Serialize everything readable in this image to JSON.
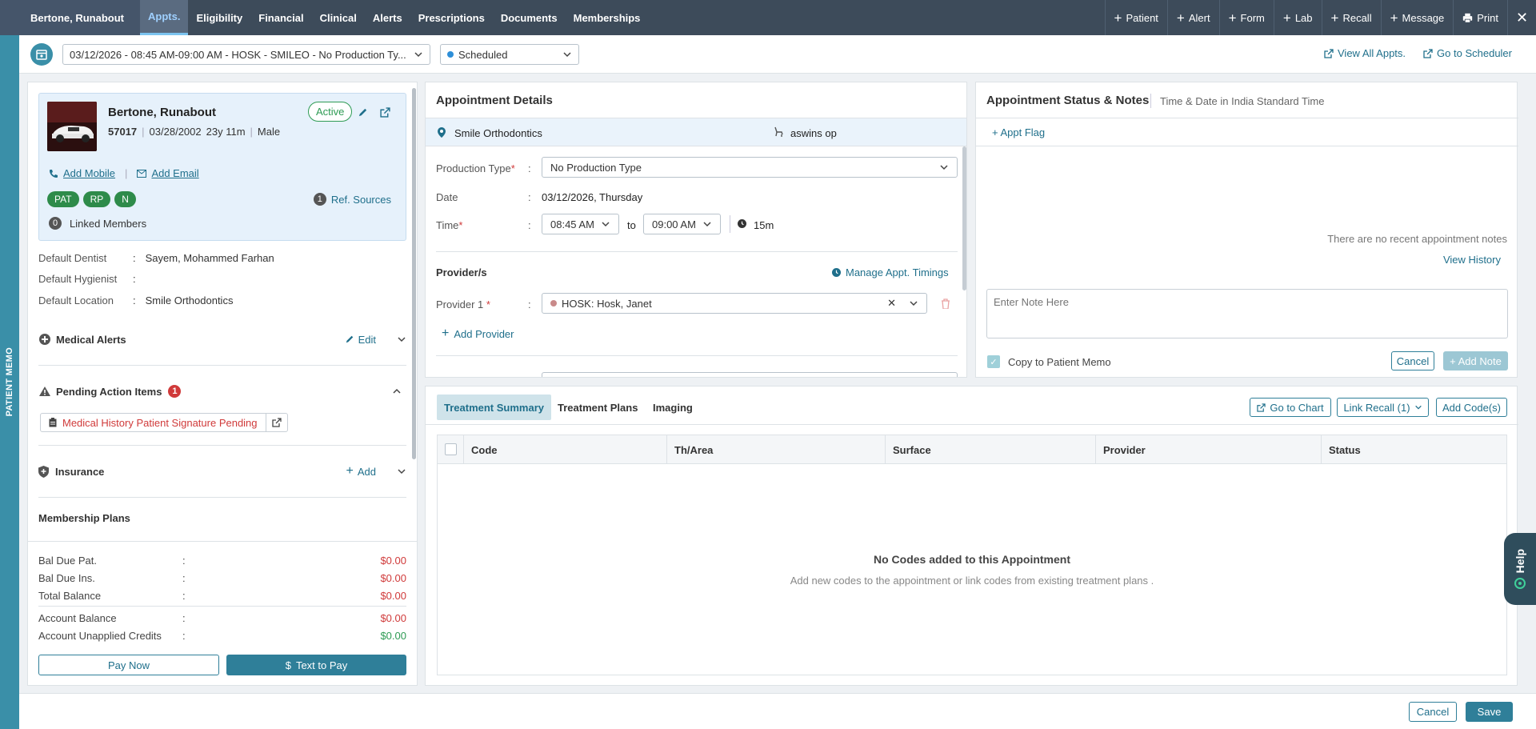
{
  "topbar": {
    "patient": "Bertone, Runabout",
    "nav": [
      "Appts.",
      "Eligibility",
      "Financial",
      "Clinical",
      "Alerts",
      "Prescriptions",
      "Documents",
      "Memberships"
    ],
    "actions": [
      "Patient",
      "Alert",
      "Form",
      "Lab",
      "Recall",
      "Message"
    ],
    "print": "Print"
  },
  "memo_strip": "PATIENT MEMO",
  "appt_bar": {
    "appointment": "03/12/2026 - 08:45 AM-09:00 AM - HOSK - SMILEO - No Production Ty...",
    "status": "Scheduled",
    "view_all": "View All Appts.",
    "go_scheduler": "Go to Scheduler"
  },
  "patient": {
    "name": "Bertone, Runabout",
    "id": "57017",
    "dob": "03/28/2002",
    "age": "23y 11m",
    "gender": "Male",
    "status": "Active",
    "add_mobile": "Add Mobile",
    "add_email": "Add Email",
    "pills": [
      "PAT",
      "RP",
      "N"
    ],
    "ref_count": "1",
    "ref_label": "Ref. Sources",
    "linked_count": "0",
    "linked_label": "Linked Members"
  },
  "defaults": [
    {
      "k": "Default Dentist",
      "v": "Sayem, Mohammed Farhan"
    },
    {
      "k": "Default Hygienist",
      "v": ""
    },
    {
      "k": "Default Location",
      "v": "Smile Orthodontics"
    }
  ],
  "sections": {
    "medical_alerts": "Medical Alerts",
    "edit": "Edit",
    "pending": "Pending Action Items",
    "pending_count": "1",
    "pending_item": "Medical History Patient Signature Pending",
    "insurance": "Insurance",
    "add": "Add",
    "membership": "Membership Plans"
  },
  "balances": [
    {
      "k": "Bal Due Pat.",
      "v": "$0.00",
      "color": "#d03a3a"
    },
    {
      "k": "Bal Due Ins.",
      "v": "$0.00",
      "color": "#d03a3a"
    },
    {
      "k": "Total Balance",
      "v": "$0.00",
      "color": "#d03a3a"
    },
    {
      "k": "Account Balance",
      "v": "$0.00",
      "color": "#d03a3a"
    },
    {
      "k": "Account Unapplied Credits",
      "v": "$0.00",
      "color": "#2e9b54"
    }
  ],
  "pay_now": "Pay Now",
  "text_to_pay": "Text to Pay",
  "appt_details": {
    "title": "Appointment Details",
    "location": "Smile Orthodontics",
    "operatory": "aswins op",
    "production_label": "Production Type",
    "production_value": "No Production Type",
    "date_label": "Date",
    "date_value": "03/12/2026, Thursday",
    "time_label": "Time",
    "time_from": "08:45 AM",
    "to": "to",
    "time_to": "09:00 AM",
    "duration": "15m",
    "providers_label": "Provider/s",
    "manage_timings": "Manage Appt. Timings",
    "provider1_label": "Provider 1",
    "provider1_value": "HOSK: Hosk, Janet",
    "add_provider": "Add Provider"
  },
  "status_notes": {
    "title": "Appointment Status & Notes",
    "tz": "Time & Date in India Standard Time",
    "appt_flag": "+ Appt Flag",
    "no_notes": "There are no recent appointment notes",
    "view_history": "View History",
    "note_placeholder": "Enter Note Here",
    "copy_memo": "Copy to Patient Memo",
    "cancel": "Cancel",
    "add_note": "+ Add Note"
  },
  "treatment": {
    "tabs": [
      "Treatment Summary",
      "Treatment Plans",
      "Imaging"
    ],
    "go_chart": "Go to Chart",
    "link_recall": "Link Recall (1)",
    "add_codes": "Add Code(s)",
    "columns": [
      "Code",
      "Th/Area",
      "Surface",
      "Provider",
      "Status"
    ],
    "empty_title": "No Codes added to this Appointment",
    "empty_sub": "Add new codes to the appointment or link codes from existing treatment plans ."
  },
  "footer": {
    "cancel": "Cancel",
    "save": "Save"
  },
  "help": "Help",
  "colors": {
    "accent": "#2f7f99",
    "topbar": "#3d4b5a",
    "alert_red": "#d03a3a",
    "green": "#2e9b54"
  }
}
